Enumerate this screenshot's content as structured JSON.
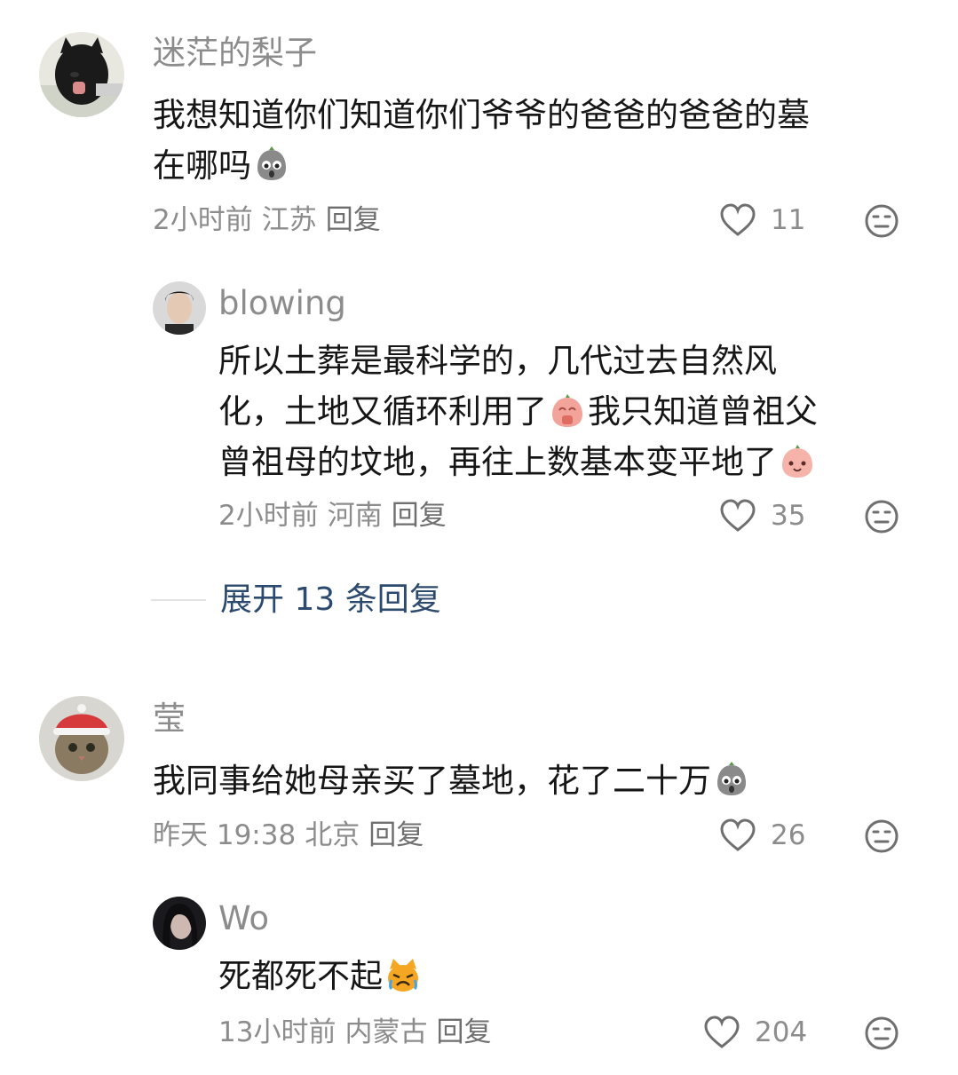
{
  "comments": [
    {
      "username": "迷茫的梨子",
      "avatar": "black-cat-avatar",
      "lines": [
        "我想知道你们知道你们爷爷的爸爸的爸爸的墓",
        "在哪吗"
      ],
      "emoji": "shocked-face-emoji",
      "time": "2小时前",
      "location": "江苏",
      "reply_label": "回复",
      "likes": "11"
    },
    {
      "username": "blowing",
      "avatar": "man-portrait-avatar",
      "lines": [
        "所以土葬是最科学的，几代过去自然风",
        "化，土地又循环利用了",
        "我只知道曾祖父",
        "曾祖母的坟地，再往上数基本变平地了"
      ],
      "time": "2小时前",
      "location": "河南",
      "reply_label": "回复",
      "likes": "35"
    },
    {
      "username": "莹",
      "avatar": "cat-santa-hat-avatar",
      "lines": [
        "我同事给她母亲买了墓地，花了二十万"
      ],
      "time": "昨天 19:38",
      "location": "北京",
      "reply_label": "回复",
      "likes": "26"
    },
    {
      "username": "Wo",
      "avatar": "woman-portrait-avatar",
      "lines": [
        "死都死不起"
      ],
      "time": "13小时前",
      "location": "内蒙古",
      "reply_label": "回复",
      "likes": "204"
    }
  ],
  "expand_replies": "展开 13 条回复",
  "icons": {
    "like": "heart-outline-icon",
    "dislike": "neutral-face-icon"
  },
  "colors": {
    "username": "#8c8c8c",
    "text": "#161616",
    "meta": "#8c8c8c",
    "expand_link": "#2c4a6e"
  }
}
